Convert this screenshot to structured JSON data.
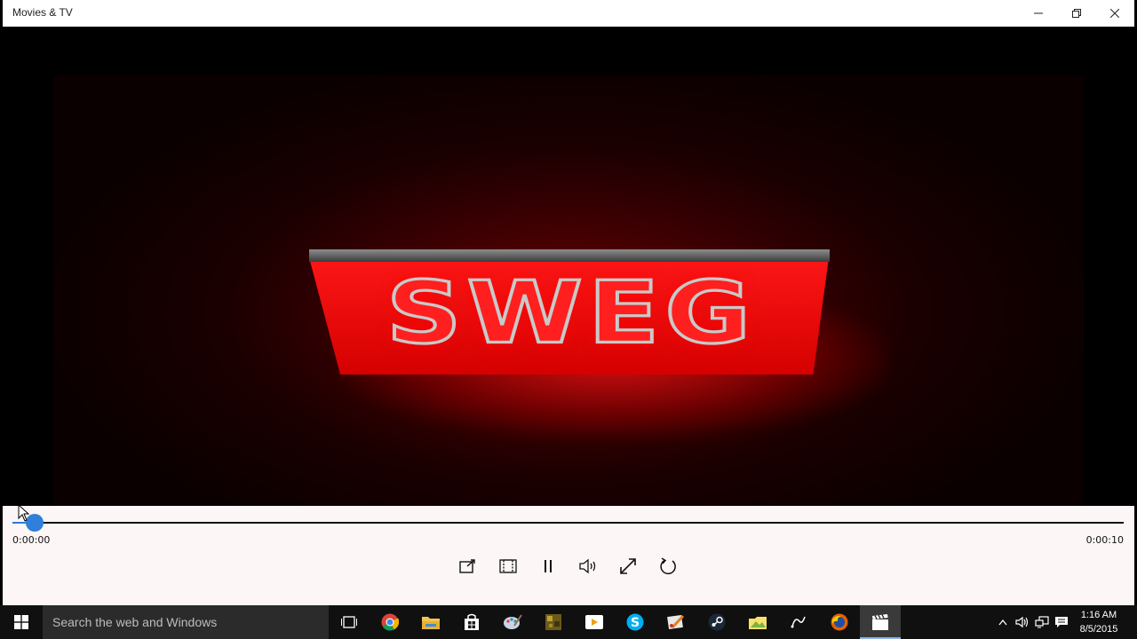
{
  "window": {
    "title": "Movies & TV",
    "minimize_icon": "minimize-icon",
    "restore_icon": "restore-icon",
    "close_icon": "close-icon"
  },
  "video": {
    "logo_text": "SWEG",
    "glow_color": "#ff1a1a"
  },
  "player": {
    "elapsed": "0:00:00",
    "duration": "0:00:10",
    "progress": 0.02,
    "accent_color": "#2f7fdb",
    "buttons": [
      {
        "name": "cast-to-device-button",
        "icon": "cast-icon"
      },
      {
        "name": "aspect-ratio-button",
        "icon": "aspect-ratio-icon"
      },
      {
        "name": "pause-button",
        "icon": "pause-icon"
      },
      {
        "name": "volume-button",
        "icon": "volume-icon"
      },
      {
        "name": "full-screen-button",
        "icon": "full-screen-icon"
      },
      {
        "name": "repeat-button",
        "icon": "repeat-icon"
      }
    ]
  },
  "taskbar": {
    "search_placeholder": "Search the web and Windows",
    "time": "1:16 AM",
    "date": "8/5/2015",
    "apps": [
      "task-view-icon",
      "chrome-icon",
      "file-explorer-icon",
      "store-icon",
      "paint-icon",
      "minecraft-icon",
      "media-player-icon",
      "skype-icon",
      "paint-net-icon",
      "steam-icon",
      "photos-icon",
      "app-icon",
      "firefox-icon",
      "movies-tv-icon"
    ]
  }
}
